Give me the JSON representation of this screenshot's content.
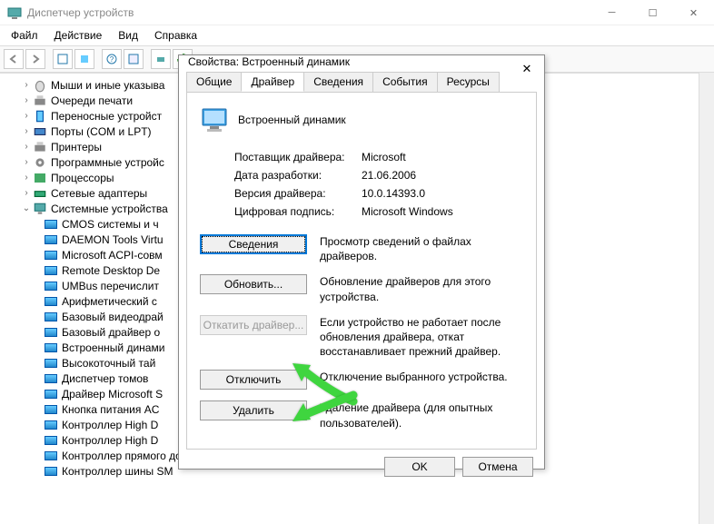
{
  "window": {
    "title": "Диспетчер устройств"
  },
  "menu": {
    "file": "Файл",
    "action": "Действие",
    "view": "Вид",
    "help": "Справка"
  },
  "tree": {
    "items": [
      {
        "label": "Мыши и иные указыва",
        "icon": "mouse",
        "expander": ">"
      },
      {
        "label": "Очереди печати",
        "icon": "printer",
        "expander": ">"
      },
      {
        "label": "Переносные устройст",
        "icon": "portable",
        "expander": ">"
      },
      {
        "label": "Порты (COM и LPT)",
        "icon": "port",
        "expander": ">"
      },
      {
        "label": "Принтеры",
        "icon": "printer",
        "expander": ">"
      },
      {
        "label": "Программные устройс",
        "icon": "gear",
        "expander": ">"
      },
      {
        "label": "Процессоры",
        "icon": "chip",
        "expander": ">"
      },
      {
        "label": "Сетевые адаптеры",
        "icon": "net",
        "expander": ">"
      },
      {
        "label": "Системные устройства",
        "icon": "pc",
        "expander": "v"
      }
    ],
    "children": [
      {
        "label": "CMOS системы и ч"
      },
      {
        "label": "DAEMON Tools Virtu"
      },
      {
        "label": "Microsoft ACPI-совм"
      },
      {
        "label": "Remote Desktop De"
      },
      {
        "label": "UMBus перечислит"
      },
      {
        "label": "Арифметический с"
      },
      {
        "label": "Базовый видеодрай"
      },
      {
        "label": "Базовый драйвер о"
      },
      {
        "label": "Встроенный динами"
      },
      {
        "label": "Высокоточный тай"
      },
      {
        "label": "Диспетчер томов"
      },
      {
        "label": "Драйвер Microsoft S"
      },
      {
        "label": "Кнопка питания AC"
      },
      {
        "label": "Контроллер High D"
      },
      {
        "label": "Контроллер High D"
      },
      {
        "label": "Контроллер прямого доступа к памяти"
      },
      {
        "label": "Контроллер шины SM"
      }
    ]
  },
  "dialog": {
    "title": "Свойства: Встроенный динамик",
    "tabs": {
      "general": "Общие",
      "driver": "Драйвер",
      "details": "Сведения",
      "events": "События",
      "resources": "Ресурсы"
    },
    "device_name": "Встроенный динамик",
    "labels": {
      "provider": "Поставщик драйвера:",
      "date": "Дата разработки:",
      "version": "Версия драйвера:",
      "signer": "Цифровая подпись:"
    },
    "values": {
      "provider": "Microsoft",
      "date": "21.06.2006",
      "version": "10.0.14393.0",
      "signer": "Microsoft Windows"
    },
    "buttons": {
      "details": "Сведения",
      "update": "Обновить...",
      "rollback": "Откатить драйвер...",
      "disable": "Отключить",
      "uninstall": "Удалить",
      "ok": "OK",
      "cancel": "Отмена"
    },
    "descriptions": {
      "details": "Просмотр сведений о файлах драйверов.",
      "update": "Обновление драйверов для этого устройства.",
      "rollback": "Если устройство не работает после обновления драйвера, откат восстанавливает прежний драйвер.",
      "disable": "Отключение выбранного устройства.",
      "uninstall": "Удаление драйвера (для опытных пользователей)."
    }
  }
}
